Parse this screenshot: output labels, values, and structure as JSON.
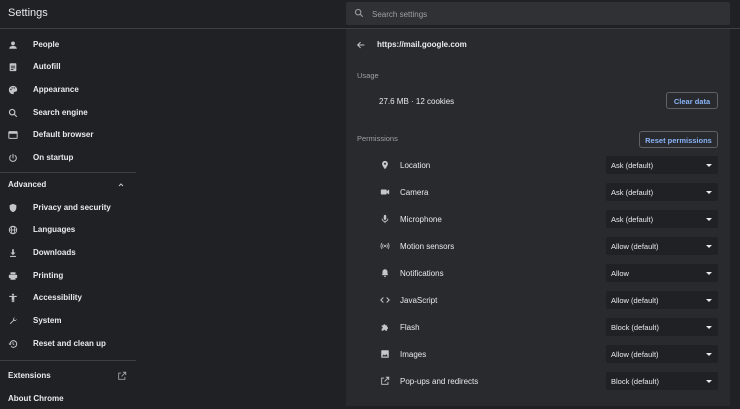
{
  "header": {
    "title": "Settings",
    "search_placeholder": "Search settings"
  },
  "sidebar": {
    "items": [
      {
        "label": "People",
        "icon": "person-icon"
      },
      {
        "label": "Autofill",
        "icon": "clipboard-icon"
      },
      {
        "label": "Appearance",
        "icon": "palette-icon"
      },
      {
        "label": "Search engine",
        "icon": "search-icon"
      },
      {
        "label": "Default browser",
        "icon": "browser-icon"
      },
      {
        "label": "On startup",
        "icon": "power-icon"
      }
    ],
    "advanced_label": "Advanced",
    "advanced_items": [
      {
        "label": "Privacy and security",
        "icon": "shield-icon"
      },
      {
        "label": "Languages",
        "icon": "globe-icon"
      },
      {
        "label": "Downloads",
        "icon": "download-icon"
      },
      {
        "label": "Printing",
        "icon": "printer-icon"
      },
      {
        "label": "Accessibility",
        "icon": "accessibility-icon"
      },
      {
        "label": "System",
        "icon": "wrench-icon"
      },
      {
        "label": "Reset and clean up",
        "icon": "history-icon"
      }
    ],
    "extensions_label": "Extensions",
    "about_label": "About Chrome"
  },
  "site": {
    "url": "https://mail.google.com",
    "usage_label": "Usage",
    "usage_text": "27.6 MB · 12 cookies",
    "clear_button": "Clear data",
    "permissions_label": "Permissions",
    "reset_button": "Reset permissions",
    "permissions": [
      {
        "label": "Location",
        "value": "Ask (default)",
        "icon": "location-icon"
      },
      {
        "label": "Camera",
        "value": "Ask (default)",
        "icon": "camera-icon"
      },
      {
        "label": "Microphone",
        "value": "Ask (default)",
        "icon": "microphone-icon"
      },
      {
        "label": "Motion sensors",
        "value": "Allow (default)",
        "icon": "motion-sensor-icon"
      },
      {
        "label": "Notifications",
        "value": "Allow",
        "icon": "bell-icon"
      },
      {
        "label": "JavaScript",
        "value": "Allow (default)",
        "icon": "code-icon"
      },
      {
        "label": "Flash",
        "value": "Block (default)",
        "icon": "puzzle-icon"
      },
      {
        "label": "Images",
        "value": "Allow (default)",
        "icon": "image-icon"
      },
      {
        "label": "Pop-ups and redirects",
        "value": "Block (default)",
        "icon": "open-external-icon"
      }
    ]
  },
  "colors": {
    "background": "#202124",
    "panel": "#292a2d",
    "accent": "#8ab4f8",
    "text": "#e8eaed"
  }
}
